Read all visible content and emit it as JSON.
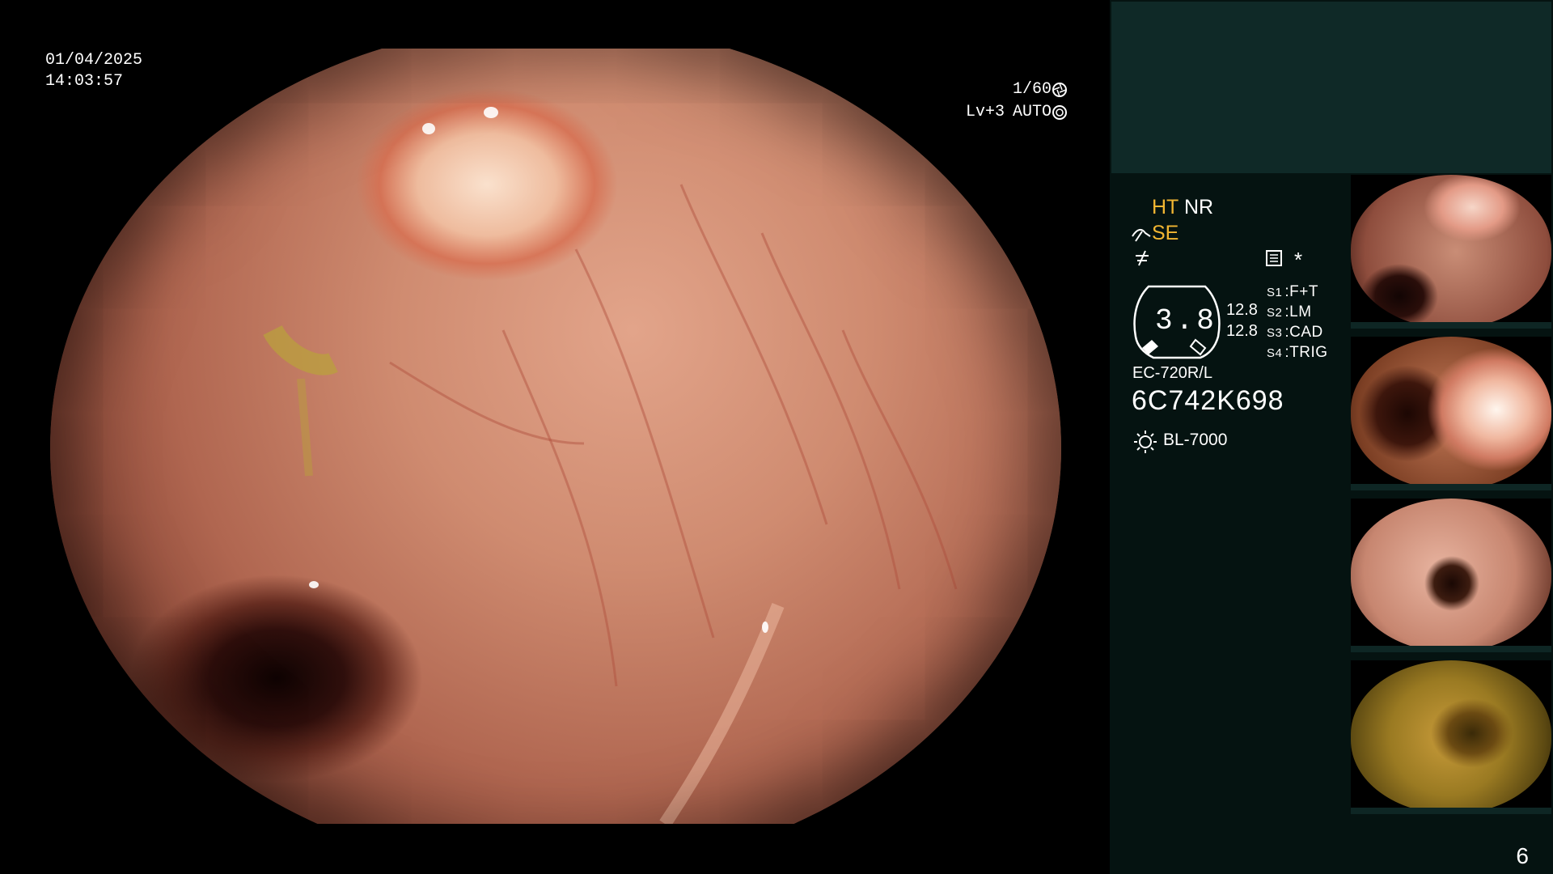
{
  "header": {
    "date": "01/04/2025",
    "time": "14:03:57"
  },
  "exposure": {
    "shutter": "1/60",
    "shutter_icon": "aperture-icon",
    "level": "Lv+3",
    "mode": "AUTO",
    "mode_icon": "iris-icon"
  },
  "modes": {
    "ht": "HT",
    "nr": "NR",
    "se": "SE",
    "se_icon": "scope-bend-icon",
    "freeze_icon": "freeze-icon",
    "menu_icon": "settings-icon",
    "asterisk": "*"
  },
  "gauge": {
    "value": "3.8",
    "right_top": "12.8",
    "right_bottom": "12.8"
  },
  "switches": [
    {
      "key": "S1",
      "value": "F+T"
    },
    {
      "key": "S2",
      "value": "LM"
    },
    {
      "key": "S3",
      "value": "CAD"
    },
    {
      "key": "S4",
      "value": "TRIG"
    }
  ],
  "scope": {
    "model": "EC-720R/L",
    "serial": "6C742K698"
  },
  "light_source": {
    "icon": "light-source-icon",
    "label": "BL-7000"
  },
  "thumbnails": [
    {
      "index": "1",
      "palette": "polyp-lumen"
    },
    {
      "index": "2",
      "palette": "polyp-closeup"
    },
    {
      "index": "3",
      "palette": "lumen-bubbles"
    },
    {
      "index": "4",
      "palette": "stool-green"
    }
  ],
  "page_number": "6",
  "colors": {
    "accent_yellow": "#f2b632",
    "panel_bg": "#051311",
    "panel_top": "#0f2927"
  }
}
